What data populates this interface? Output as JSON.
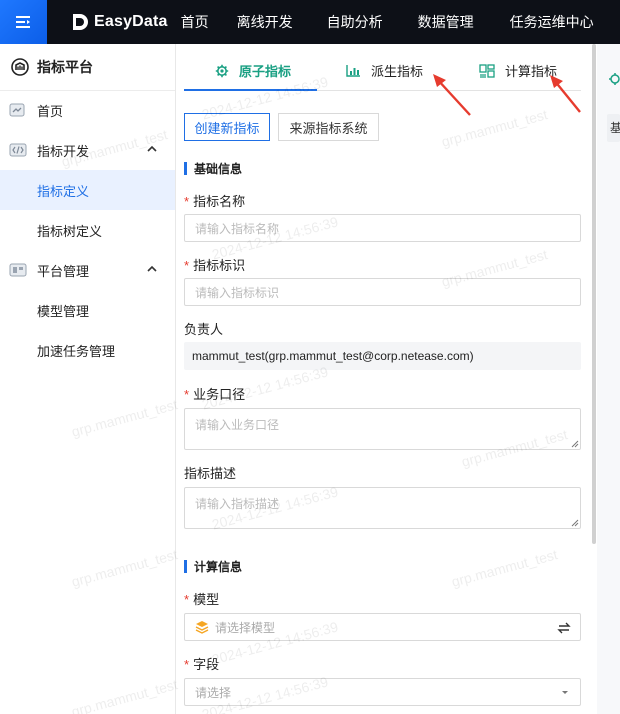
{
  "header": {
    "brand": "EasyData",
    "nav": [
      "首页",
      "离线开发",
      "自助分析",
      "数据管理",
      "任务运维中心"
    ]
  },
  "sidebar": {
    "title": "指标平台",
    "items": [
      {
        "label": "首页",
        "icon": "home-icon"
      },
      {
        "label": "指标开发",
        "icon": "code-icon",
        "expanded": true
      },
      {
        "label": "指标定义",
        "active": true
      },
      {
        "label": "指标树定义"
      },
      {
        "label": "平台管理",
        "icon": "settings-icon",
        "expanded": true
      },
      {
        "label": "模型管理"
      },
      {
        "label": "加速任务管理"
      }
    ]
  },
  "tabs": [
    {
      "label": "原子指标",
      "icon": "gear-icon",
      "active": true
    },
    {
      "label": "派生指标",
      "icon": "bar-chart-icon"
    },
    {
      "label": "计算指标",
      "icon": "calculator-icon"
    }
  ],
  "mode": {
    "create": "创建新指标",
    "source": "来源指标系统"
  },
  "basic": {
    "section": "基础信息",
    "name_label": "指标名称",
    "name_placeholder": "请输入指标名称",
    "id_label": "指标标识",
    "id_placeholder": "请输入指标标识",
    "owner_label": "负责人",
    "owner_value": "mammut_test(grp.mammut_test@corp.netease.com)",
    "scope_label": "业务口径",
    "scope_placeholder": "请输入业务口径",
    "desc_label": "指标描述",
    "desc_placeholder": "请输入指标描述"
  },
  "calc": {
    "section": "计算信息",
    "model_label": "模型",
    "model_placeholder": "请选择模型",
    "field_label": "字段",
    "field_placeholder": "请选择"
  },
  "watermark": {
    "user": "grp.mammut_test",
    "time": "2024-12-12 14:56:39"
  },
  "right_strip": {
    "box_text": "基"
  },
  "colors": {
    "accent": "#1f6fe5",
    "active_tab": "#1aa083",
    "annotation_arrow": "#e63b2e",
    "topbar": "#0d1017"
  }
}
